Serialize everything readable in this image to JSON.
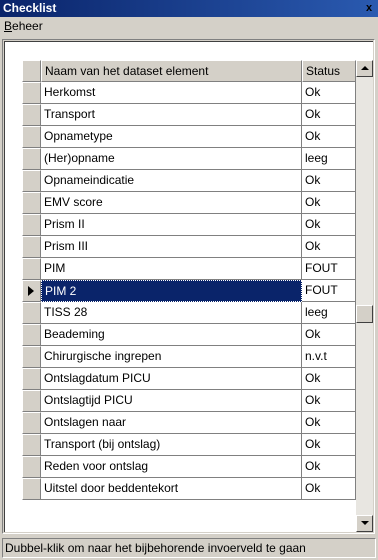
{
  "window": {
    "title": "Checklist",
    "close_glyph": "x"
  },
  "menu": {
    "items": [
      {
        "label": "Beheer",
        "accel": "B",
        "rest": "eheer"
      }
    ]
  },
  "grid": {
    "columns": [
      "Naam van het dataset element",
      "Status"
    ],
    "rows": [
      {
        "name": "Herkomst",
        "status": "Ok"
      },
      {
        "name": "Transport",
        "status": "Ok"
      },
      {
        "name": "Opnametype",
        "status": "Ok"
      },
      {
        "name": "(Her)opname",
        "status": "leeg"
      },
      {
        "name": "Opnameindicatie",
        "status": "Ok"
      },
      {
        "name": "EMV score",
        "status": "Ok"
      },
      {
        "name": "Prism II",
        "status": "Ok"
      },
      {
        "name": "Prism III",
        "status": "Ok"
      },
      {
        "name": "PIM",
        "status": "FOUT"
      },
      {
        "name": "PIM 2",
        "status": "FOUT",
        "selected": true
      },
      {
        "name": "TISS 28",
        "status": "leeg"
      },
      {
        "name": "Beademing",
        "status": "Ok"
      },
      {
        "name": "Chirurgische ingrepen",
        "status": "n.v.t"
      },
      {
        "name": "Ontslagdatum PICU",
        "status": "Ok"
      },
      {
        "name": "Ontslagtijd PICU",
        "status": "Ok"
      },
      {
        "name": "Ontslagen naar",
        "status": "Ok"
      },
      {
        "name": "Transport (bij ontslag)",
        "status": "Ok"
      },
      {
        "name": "Reden voor ontslag",
        "status": "Ok"
      },
      {
        "name": "Uitstel door beddentekort",
        "status": "Ok"
      }
    ]
  },
  "statusbar": {
    "text": "Dubbel-klik om naar het bijbehorende invoerveld te gaan"
  },
  "colors": {
    "title_bg": "#0a246a",
    "selection_bg": "#0a246a",
    "face": "#d4d0c8"
  },
  "icons": {
    "scroll_up": "triangle-up",
    "scroll_down": "triangle-down",
    "row_pointer": "triangle-right"
  }
}
